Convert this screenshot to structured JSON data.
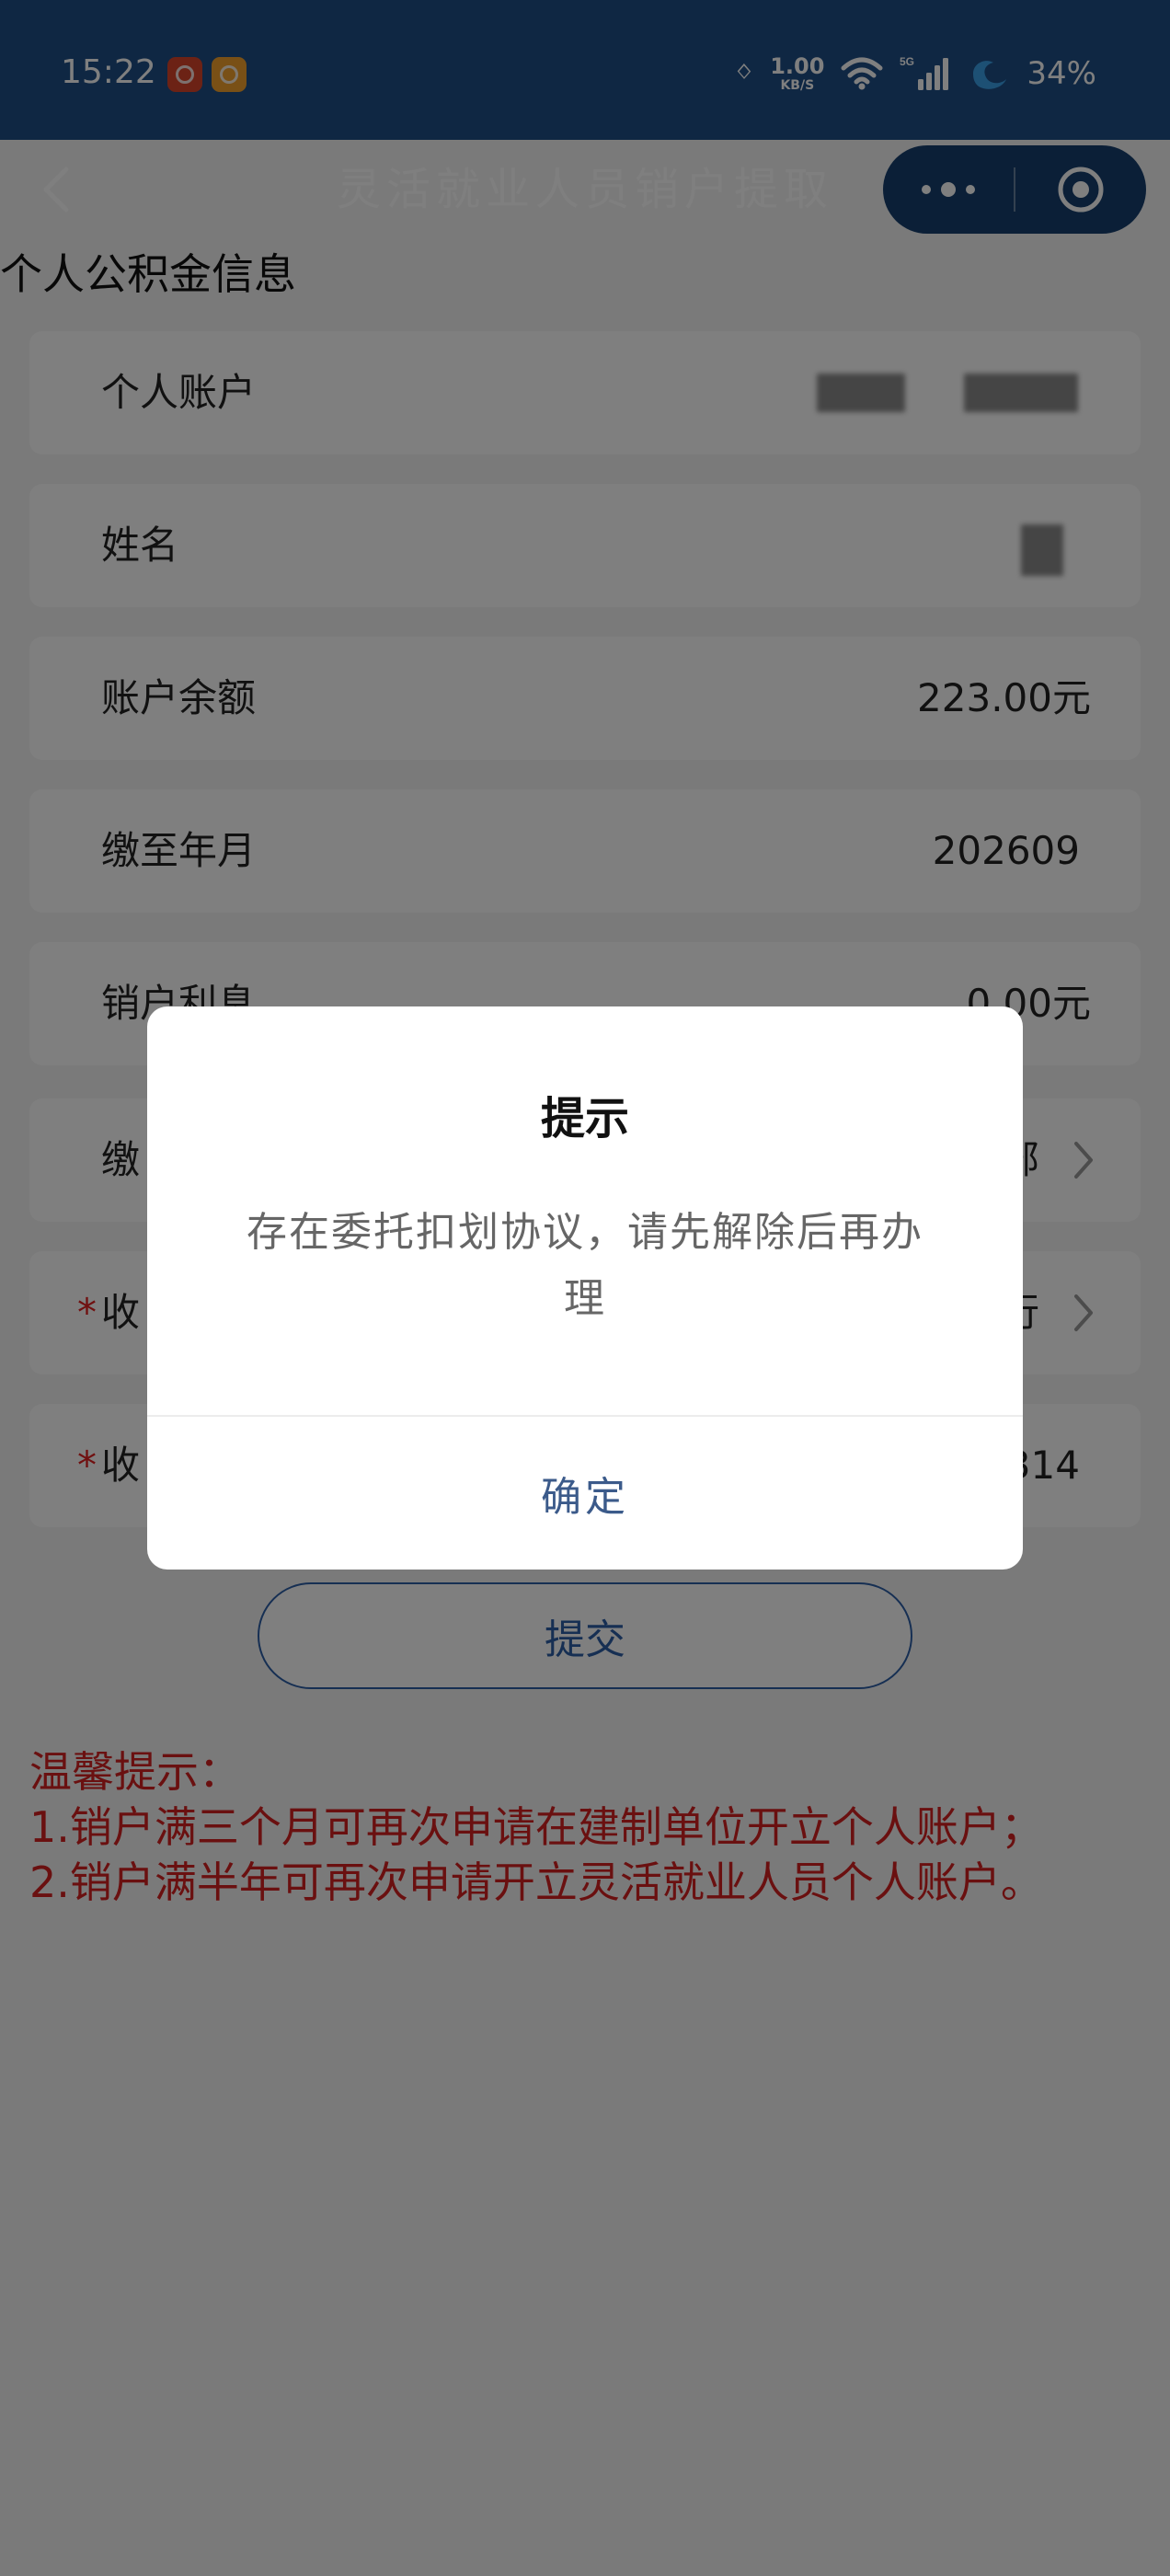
{
  "status_bar": {
    "time": "15:22",
    "network_speed": "1.00",
    "network_speed_unit": "KB/S",
    "network_type": "5G",
    "battery": "34%",
    "icons": [
      "app-icon-red",
      "app-icon-orange",
      "bluetooth-icon",
      "wifi-icon",
      "signal-icon",
      "battery-icon"
    ]
  },
  "header": {
    "title": "灵活就业人员销户提取",
    "back_icon": "chevron-left-icon",
    "more_icon": "more-dots-icon",
    "close_icon": "target-circle-icon",
    "background_color": "#1f4f86"
  },
  "section": {
    "title": "个人公积金信息"
  },
  "rows": [
    {
      "label": "个人账户",
      "value": ""
    },
    {
      "label": "姓名",
      "value": ""
    },
    {
      "label": "账户余额",
      "value": "223.00元"
    },
    {
      "label": "缴至年月",
      "value": "202609"
    },
    {
      "label": "销户利息",
      "value": "0.00元"
    },
    {
      "label": "缴",
      "value": "部"
    },
    {
      "label": "收",
      "value": "行",
      "required": "*"
    },
    {
      "label": "收",
      "value": "314",
      "required": "*"
    }
  ],
  "submit": {
    "label": "提交"
  },
  "tips": {
    "heading": "温馨提示：",
    "lines": [
      "1.销户满三个月可再次申请在建制单位开立个人账户；",
      "2.销户满半年可再次申请开立灵活就业人员个人账户。"
    ],
    "color": "#d52020"
  },
  "dialog": {
    "title": "提示",
    "message": "存在委托扣划协议，请先解除后再办理",
    "confirm_label": "确定"
  }
}
